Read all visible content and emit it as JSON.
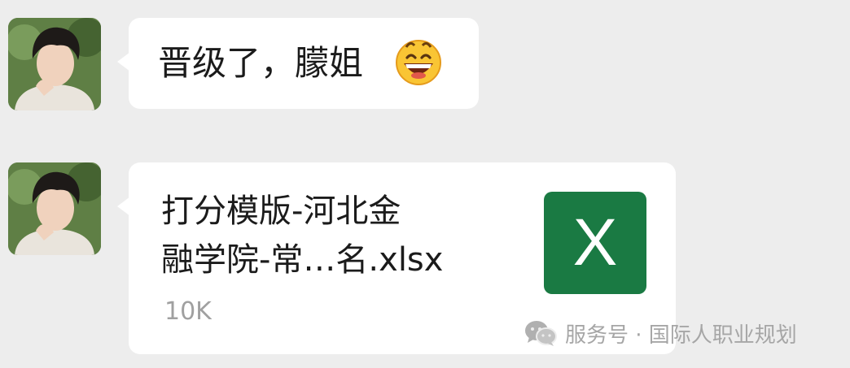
{
  "messages": [
    {
      "type": "text",
      "text": "晋级了，朦姐",
      "emoji": "grinning-face-emoji"
    },
    {
      "type": "file",
      "file_name_line1": "打分模版-河北金",
      "file_name_line2": "融学院-常…名.xlsx",
      "file_size": "10K",
      "file_icon": "excel-icon",
      "file_icon_letter": "X",
      "file_icon_color": "#1a7a43"
    }
  ],
  "watermark": {
    "icon": "wechat-icon",
    "text": "服务号 · 国际人职业规划"
  },
  "colors": {
    "background": "#ededed",
    "bubble": "#ffffff",
    "excel": "#1a7a43"
  }
}
